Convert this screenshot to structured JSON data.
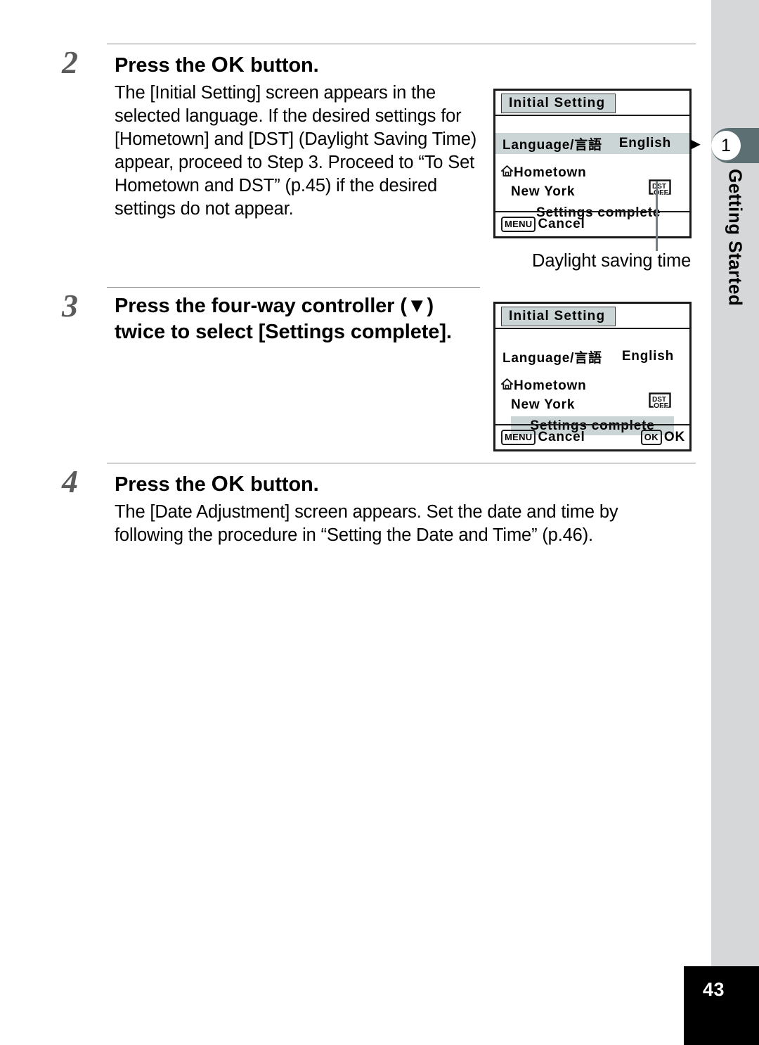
{
  "page": {
    "number": "43",
    "chapter_number": "1",
    "chapter_title": "Getting Started"
  },
  "steps": [
    {
      "number": "2",
      "title_before": "Press the ",
      "title_ok": "OK",
      "title_after": " button.",
      "body": "The [Initial Setting] screen appears in the selected language. If the desired settings for [Hometown] and [DST] (Daylight Saving Time) appear, proceed to Step 3. Proceed to “To Set Hometown and DST” (p.45) if the desired settings do not appear."
    },
    {
      "number": "3",
      "title": "Press the four-way controller (▼) twice to select [Settings complete]."
    },
    {
      "number": "4",
      "title_before": "Press the ",
      "title_ok": "OK",
      "title_after": " button.",
      "body": "The [Date Adjustment] screen appears. Set the date and time by following the procedure in “Setting the Date and Time” (p.46)."
    }
  ],
  "screens": [
    {
      "title": "Initial Setting",
      "language_label": "Language/言語",
      "language_value": "English",
      "language_arrow": "▶",
      "hometown_label": "Hometown",
      "hometown_city": "New York",
      "dst_icon_top": "DST",
      "dst_icon_bottom": "OFF",
      "settings_complete": "Settings complete",
      "menu_badge": "MENU",
      "menu_label": "Cancel",
      "ok_badge": "",
      "ok_label": ""
    },
    {
      "title": "Initial Setting",
      "language_label": "Language/言語",
      "language_value": "English",
      "language_arrow": "",
      "hometown_label": "Hometown",
      "hometown_city": "New York",
      "dst_icon_top": "DST",
      "dst_icon_bottom": "OFF",
      "settings_complete": "Settings complete",
      "menu_badge": "MENU",
      "menu_label": "Cancel",
      "ok_badge": "OK",
      "ok_label": "OK"
    }
  ],
  "caption": {
    "daylight_saving_time": "Daylight saving time"
  },
  "colors": {
    "band": "#d6d7d8",
    "tab": "#5c6f73",
    "highlight": "#ccd5d6",
    "step_number": "#5b5b5b",
    "leader": "#6f8084"
  }
}
